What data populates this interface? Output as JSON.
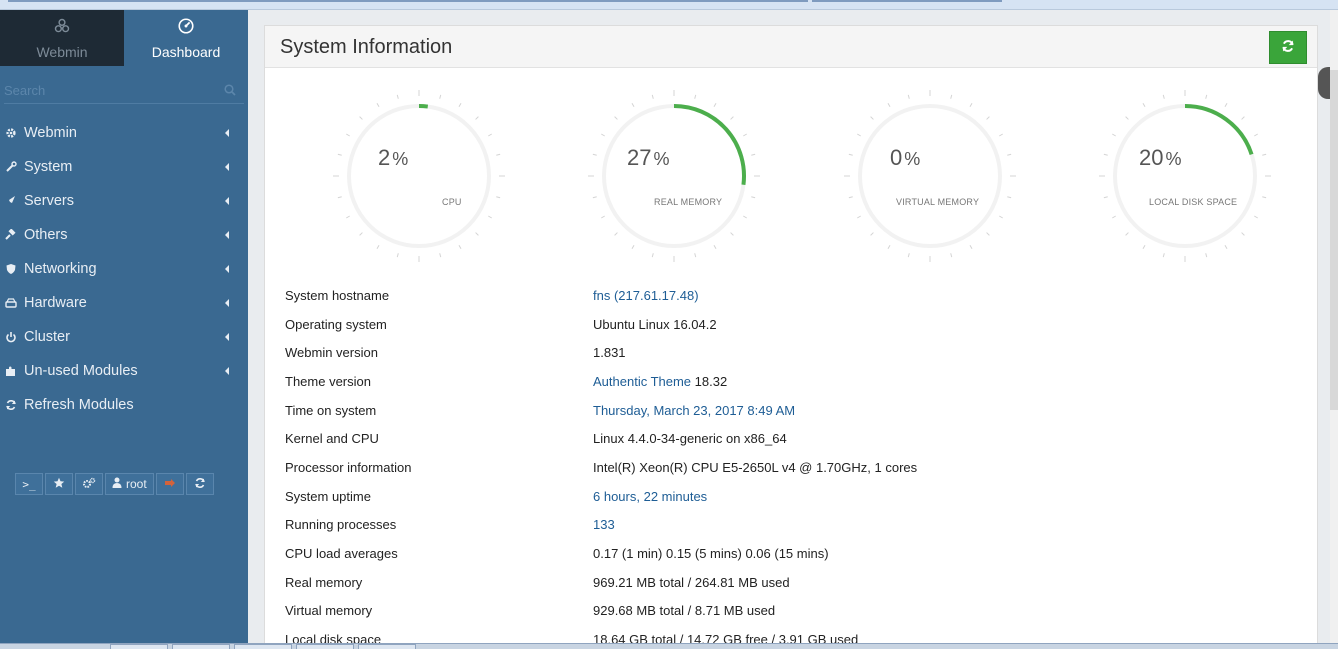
{
  "sidebar": {
    "tabs": [
      {
        "label": "Webmin",
        "icon": "webmin-logo-icon"
      },
      {
        "label": "Dashboard",
        "icon": "dashboard-icon"
      }
    ],
    "search_placeholder": "Search",
    "menu": [
      {
        "label": "Webmin",
        "icon": "gear-icon"
      },
      {
        "label": "System",
        "icon": "wrench-icon"
      },
      {
        "label": "Servers",
        "icon": "rocket-icon"
      },
      {
        "label": "Others",
        "icon": "gavel-icon"
      },
      {
        "label": "Networking",
        "icon": "shield-icon"
      },
      {
        "label": "Hardware",
        "icon": "hdd-icon"
      },
      {
        "label": "Cluster",
        "icon": "power-icon"
      },
      {
        "label": "Un-used Modules",
        "icon": "puzzle-icon"
      },
      {
        "label": "Refresh Modules",
        "icon": "refresh-icon"
      }
    ],
    "tools": {
      "user": "root"
    }
  },
  "panel": {
    "title": "System Information"
  },
  "gauges": [
    {
      "value": "2",
      "unit": "%",
      "label": "CPU",
      "fraction": 0.02
    },
    {
      "value": "27",
      "unit": "%",
      "label": "REAL MEMORY",
      "fraction": 0.27
    },
    {
      "value": "0",
      "unit": "%",
      "label": "VIRTUAL MEMORY",
      "fraction": 0.0
    },
    {
      "value": "20",
      "unit": "%",
      "label": "LOCAL DISK SPACE",
      "fraction": 0.2
    }
  ],
  "info": [
    {
      "key": "System hostname",
      "link": "fns (217.61.17.48)",
      "text": ""
    },
    {
      "key": "Operating system",
      "link": "",
      "text": "Ubuntu Linux 16.04.2"
    },
    {
      "key": "Webmin version",
      "link": "",
      "text": "1.831"
    },
    {
      "key": "Theme version",
      "link": "Authentic Theme",
      "text": " 18.32"
    },
    {
      "key": "Time on system",
      "link": "Thursday, March 23, 2017 8:49 AM",
      "text": ""
    },
    {
      "key": "Kernel and CPU",
      "link": "",
      "text": "Linux 4.4.0-34-generic on x86_64"
    },
    {
      "key": "Processor information",
      "link": "",
      "text": "Intel(R) Xeon(R) CPU E5-2650L v4 @ 1.70GHz, 1 cores"
    },
    {
      "key": "System uptime",
      "link": "6 hours, 22 minutes",
      "text": ""
    },
    {
      "key": "Running processes",
      "link": "133",
      "text": ""
    },
    {
      "key": "CPU load averages",
      "link": "",
      "text": "0.17 (1 min) 0.15 (5 mins) 0.06 (15 mins)"
    },
    {
      "key": "Real memory",
      "link": "",
      "text": "969.21 MB total / 264.81 MB used"
    },
    {
      "key": "Virtual memory",
      "link": "",
      "text": "929.68 MB total / 8.71 MB used"
    },
    {
      "key": "Local disk space",
      "link": "",
      "text": "18.64 GB total / 14.72 GB free / 3.91 GB used"
    }
  ],
  "colors": {
    "sidebar_bg": "#3a6991",
    "gauge_active": "#4cae4c",
    "gauge_track": "#f2f2f2",
    "link": "#1e5d95",
    "refresh_button": "#3aa53a"
  }
}
